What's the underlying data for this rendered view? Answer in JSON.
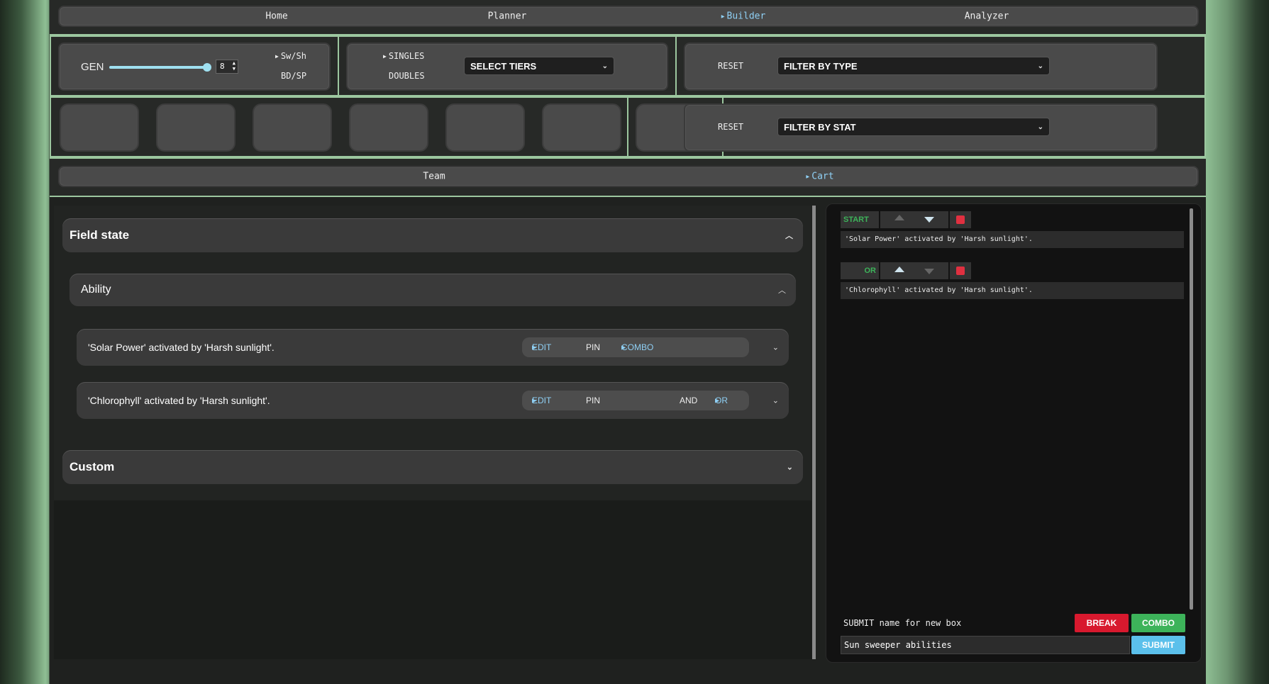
{
  "nav": {
    "items": [
      {
        "label": "Home",
        "active": false
      },
      {
        "label": "Planner",
        "active": false
      },
      {
        "label": "Builder",
        "active": true
      },
      {
        "label": "Analyzer",
        "active": false
      }
    ]
  },
  "gen": {
    "label": "GEN",
    "value": "8",
    "slider_fraction": 1.0,
    "opt1": "Sw/Sh",
    "opt2": "BD/SP"
  },
  "format": {
    "singles": "SINGLES",
    "doubles": "DOUBLES",
    "tiers_select": "SELECT TIERS"
  },
  "type_filter": {
    "reset": "RESET",
    "select": "FILTER BY TYPE"
  },
  "stat_filter": {
    "reset": "RESET",
    "select": "FILTER BY STAT"
  },
  "subnav": {
    "team": "Team",
    "cart": "Cart"
  },
  "field_state": {
    "title": "Field state",
    "ability": {
      "title": "Ability",
      "rows": [
        {
          "text": "'Solar Power' activated by 'Harsh sunlight'.",
          "edit": "EDIT",
          "pin": "PIN",
          "combo": "COMBO"
        },
        {
          "text": "'Chlorophyll' activated by 'Harsh sunlight'.",
          "edit": "EDIT",
          "pin": "PIN",
          "and": "AND",
          "or": "OR"
        }
      ]
    },
    "custom": "Custom"
  },
  "builder": {
    "entries": [
      {
        "tag": "START",
        "text": "'Solar Power' activated by 'Harsh sunlight'."
      },
      {
        "tag": "OR",
        "text": "'Chlorophyll' activated by 'Harsh sunlight'."
      }
    ],
    "prompt": "SUBMIT name for new box",
    "break": "BREAK",
    "combo": "COMBO",
    "input_value": "Sun sweeper abilities",
    "submit": "SUBMIT"
  },
  "colors": {
    "accent": "#8fd0f5",
    "green": "#3db35a",
    "red": "#d8192e",
    "submit": "#5bc0eb",
    "border": "#9cc79f"
  }
}
